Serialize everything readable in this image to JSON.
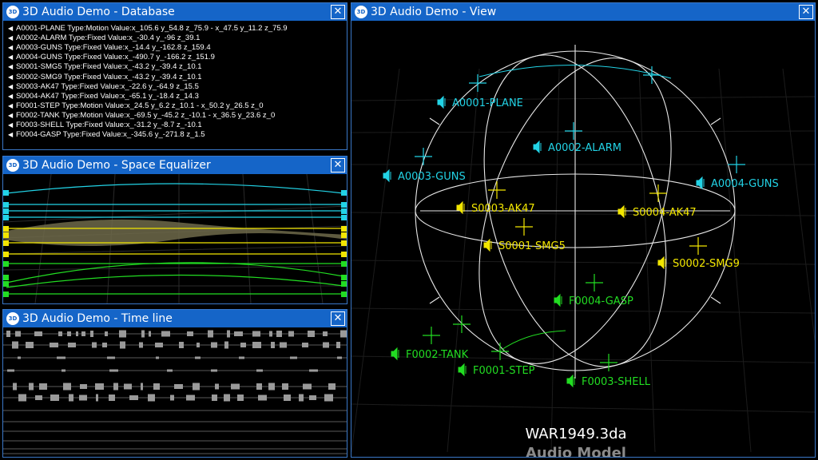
{
  "windows": {
    "database": {
      "title": "3D Audio Demo - Database"
    },
    "equalizer": {
      "title": "3D Audio Demo - Space Equalizer"
    },
    "timeline": {
      "title": "3D Audio Demo - Time line"
    },
    "view": {
      "title": "3D Audio Demo - View"
    }
  },
  "app_logo": "3D",
  "close_glyph": "✕",
  "database": {
    "speaker_glyph": "◀",
    "rows": [
      "A0001-PLANE Type:Motion Value:x_105.6 y_54.8 z_75.9 - x_47.5 y_11.2 z_75.9",
      "A0002-ALARM Type:Fixed Value:x_-30.4 y_-96 z_39.1",
      "A0003-GUNS Type:Fixed Value:x_-14.4 y_-162.8 z_159.4",
      "A0004-GUNS Type:Fixed Value:x_-490.7 y_-166.2 z_151.9",
      "S0001-SMG5 Type:Fixed Value:x_-43.2 y_-39.4 z_10.1",
      "S0002-SMG9 Type:Fixed Value:x_-43.2 y_-39.4 z_10.1",
      "S0003-AK47 Type:Fixed Value:x_-22.6 y_-64.9 z_15.5",
      "S0004-AK47 Type:Fixed Value:x_-65.1 y_-18.4 z_14.3",
      "F0001-STEP Type:Motion Value:x_24.5 y_6.2 z_10.1 - x_50.2 y_26.5 z_0",
      "F0002-TANK Type:Motion Value:x_-69.5 y_-45.2 z_-10.1 - x_36.5 y_23.6 z_0",
      "F0003-SHELL Type:Fixed Value:x_-31.2 y_-8.7 z_-10.1",
      "F0004-GASP Type:Fixed Value:x_-345.6 y_-271.8 z_1.5"
    ]
  },
  "view": {
    "sources": [
      {
        "label": "A0001-PLANE",
        "group": "A"
      },
      {
        "label": "A0002-ALARM",
        "group": "A"
      },
      {
        "label": "A0003-GUNS",
        "group": "A"
      },
      {
        "label": "A0004-GUNS",
        "group": "A"
      },
      {
        "label": "S0003-AK47",
        "group": "S"
      },
      {
        "label": "S0004-AK47",
        "group": "S"
      },
      {
        "label": "S0001-SMG5",
        "group": "S"
      },
      {
        "label": "S0002-SMG9",
        "group": "S"
      },
      {
        "label": "F0004-GASP",
        "group": "F"
      },
      {
        "label": "F0002-TANK",
        "group": "F"
      },
      {
        "label": "F0001-STEP",
        "group": "F"
      },
      {
        "label": "F0003-SHELL",
        "group": "F"
      }
    ],
    "filename": "WAR1949.3da",
    "model_label": "Audio Model"
  },
  "colors": {
    "A": "#22d3e6",
    "S": "#f2e600",
    "F": "#22dd22",
    "titlebar": "#1565c8",
    "sphere": "#e8e8e8"
  }
}
